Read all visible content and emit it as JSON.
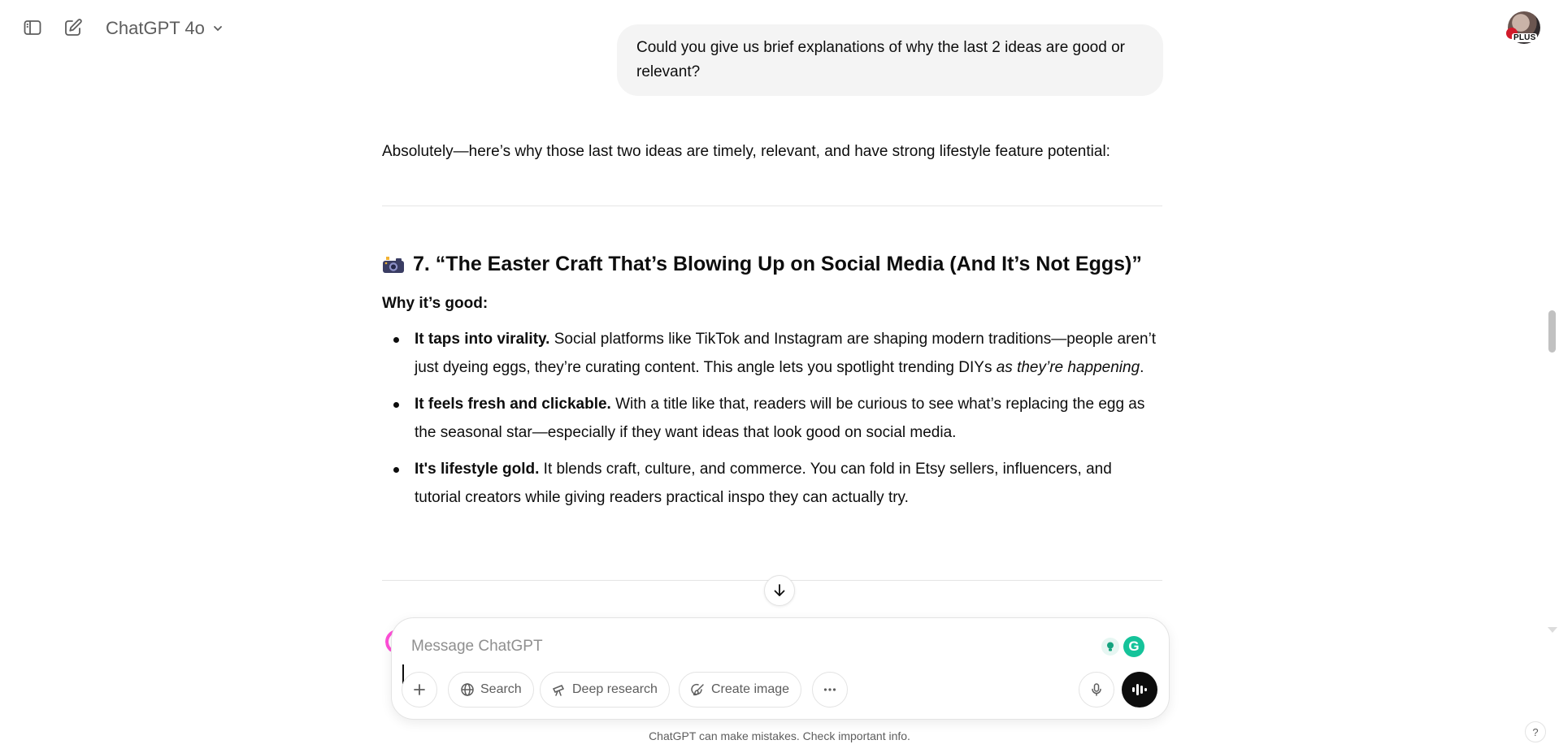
{
  "header": {
    "model_name": "ChatGPT 4o",
    "plan_badge": "PLUS"
  },
  "conversation": {
    "user_message": "Could you give us brief explanations of why the last 2 ideas are good or relevant?",
    "assistant": {
      "intro": "Absolutely—here’s why those last two ideas are timely, relevant, and have strong lifestyle feature potential:",
      "section_heading": "7. “The Easter Craft That’s Blowing Up on Social Media (And It’s Not Eggs)”",
      "section_icon": "camera-with-flash-emoji",
      "subheading": "Why it’s good:",
      "bullets": [
        {
          "bold": "It taps into virality.",
          "text": " Social platforms like TikTok and Instagram are shaping modern traditions—people aren’t just dyeing eggs, they’re curating content. This angle lets you spotlight trending DIYs ",
          "italic": "as they’re happening",
          "tail": "."
        },
        {
          "bold": "It feels fresh and clickable.",
          "text": " With a title like that, readers will be curious to see what’s replacing the egg as the seasonal star—especially if they want ideas that look good on social media."
        },
        {
          "bold": "It's lifestyle gold.",
          "text": " It blends craft, culture, and commerce. You can fold in Etsy sellers, influencers, and tutorial creators while giving readers practical inspo they can actually try."
        }
      ]
    }
  },
  "composer": {
    "placeholder": "Message ChatGPT",
    "tools": {
      "search": "Search",
      "deep_research": "Deep research",
      "create_image": "Create image"
    },
    "grammarly_letter": "G"
  },
  "footer": {
    "disclaimer": "ChatGPT can make mistakes. Check important info.",
    "help": "?"
  },
  "colors": {
    "bubble_bg": "#f4f4f4",
    "text": "#0d0d0d",
    "muted": "#5d5d5d",
    "accent_pink": "#ff4fd8",
    "grammarly_green": "#15c39a"
  }
}
